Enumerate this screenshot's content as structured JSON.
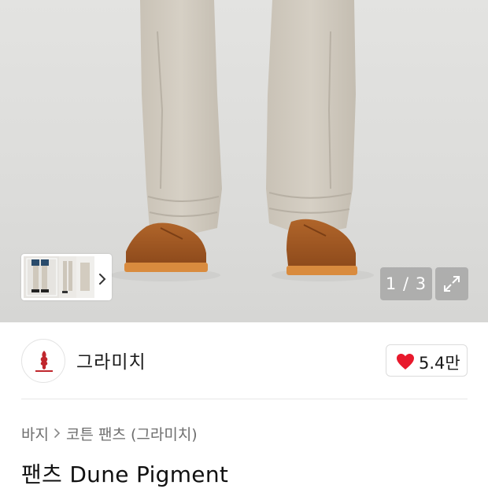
{
  "gallery": {
    "counter_text": "1 / 3",
    "current_index": 1,
    "total": 3
  },
  "brand": {
    "name": "그라미치"
  },
  "like": {
    "count": "5.4만",
    "heart_color": "#e8192c"
  },
  "breadcrumb": {
    "items": [
      "바지",
      "코튼 팬츠 (그라미치)"
    ]
  },
  "product": {
    "title": "팬츠 Dune Pigment"
  },
  "icons": {
    "thumb_next": "chevron-right-icon",
    "expand": "expand-icon",
    "heart": "heart-icon",
    "crumb_sep": "chevron-right-icon"
  }
}
